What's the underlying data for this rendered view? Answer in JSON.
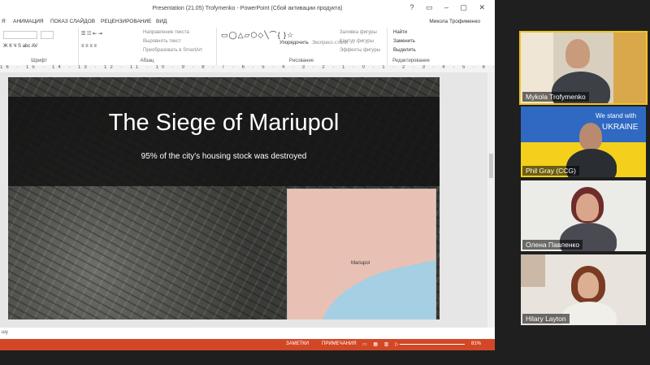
{
  "ppt": {
    "window_title": "Presentation (21.05) Trofymenko - PowerPoint (Сбой активации продукта)",
    "window_controls": "?  ▭  –  ▢  ✕",
    "user_name": "Микола Трофименко",
    "tabs": [
      "Я",
      "АНИМАЦИЯ",
      "ПОКАЗ СЛАЙДОВ",
      "РЕЦЕНЗИРОВАНИЕ",
      "ВИД"
    ],
    "ribbon": {
      "font_label": "Шрифт",
      "paragraph_label": "Абзац",
      "paragraph_cmds": [
        "Направление текста",
        "Выровнять текст",
        "Преобразовать в SmartArt"
      ],
      "drawing_label": "Рисование",
      "arrange": "Упорядочить",
      "quick_styles": "Экспресс-стили",
      "shape_cmds": [
        "Заливка фигуры",
        "Контур фигуры",
        "Эффекты фигуры"
      ],
      "editing_label": "Редактирование",
      "editing_cmds": [
        "Найти",
        "Заменить",
        "Выделить"
      ]
    },
    "ruler": "16 · 15 · 14 · 13 · 12 · 11 · 10 · 9 · 8 · 7 · 6 · 5 · 4 · 3 · 2 · 1 · 0 · 1 · 2 · 3 · 4 · 5 · 6 · 7 · 8 · 9 · 10 · 11 · 12 · 13 · 14 · 15 · 16",
    "slide": {
      "title": "The Siege of Mariupol",
      "subtitle": "95% of the city's housing stock was destroyed",
      "map_city": "Mariupol"
    },
    "notes_hint": "шу",
    "status": {
      "notes": "ЗАМЕТКИ",
      "comments": "ПРИМЕЧАНИЯ",
      "zoom": "81%"
    }
  },
  "participants": [
    {
      "name": "Mykola Trofymenko",
      "active": true
    },
    {
      "name": "Phil Gray (CCG)",
      "flag_text_1": "We stand with",
      "flag_text_2": "UKRAINE"
    },
    {
      "name": "Олена Павленко"
    },
    {
      "name": "Hilary Layton"
    }
  ],
  "colors": {
    "status_bar": "#d24726",
    "speaker_outline": "#f2c31d",
    "ua_blue": "#2f69c2",
    "ua_yellow": "#f4d01d"
  }
}
